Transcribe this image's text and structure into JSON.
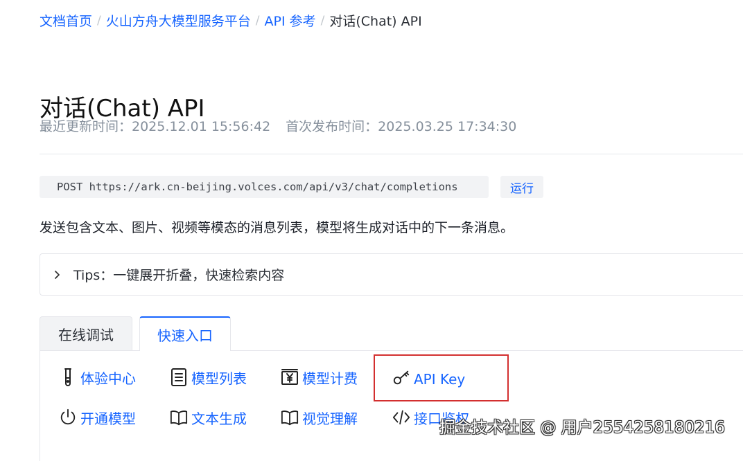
{
  "breadcrumb": {
    "items": [
      "文档首页",
      "火山方舟大模型服务平台",
      "API 参考"
    ],
    "separator": "/",
    "current": "对话(Chat) API"
  },
  "page": {
    "title": "对话(Chat) API",
    "updated": "最近更新时间：2025.12.01 15:56:42",
    "published": "首次发布时间：2025.03.25 17:34:30"
  },
  "endpoint": {
    "text": "POST https://ark.cn-beijing.volces.com/api/v3/chat/completions",
    "run_label": "运行"
  },
  "description": "发送包含文本、图片、视频等模态的消息列表，模型将生成对话中的下一条消息。",
  "tips": {
    "label": "Tips：一键展开折叠，快速检索内容"
  },
  "tabs": [
    {
      "label": "在线调试",
      "active": false
    },
    {
      "label": "快速入口",
      "active": true
    }
  ],
  "quick_links": {
    "experience_center": "体验中心",
    "model_list": "模型列表",
    "model_pricing": "模型计费",
    "api_key": "API Key",
    "activate_model": "开通模型",
    "text_generation": "文本生成",
    "visual_understanding": "视觉理解",
    "interface_auth": "接口鉴权"
  },
  "icons": {
    "experience_center": "test-tube-icon",
    "model_list": "list-document-icon",
    "model_pricing": "yen-billing-icon",
    "api_key": "key-icon",
    "activate_model": "power-icon",
    "text_generation": "open-book-icon",
    "visual_understanding": "open-book-icon",
    "interface_auth": "code-icon"
  },
  "watermark": "掘金技术社区 @ 用户2554258180216",
  "colors": {
    "link": "#1664ff",
    "muted": "#86909c",
    "highlight": "#d32f2f",
    "code_bg": "#f2f3f5"
  }
}
